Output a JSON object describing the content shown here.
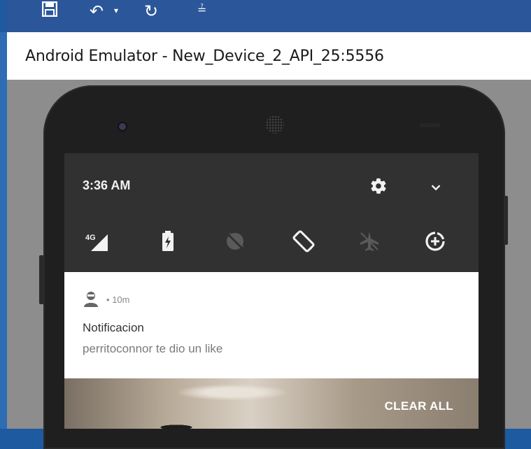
{
  "window": {
    "title": "Android Emulator - New_Device_2_API_25:5556",
    "toolbar_icons": [
      "save-icon",
      "undo-icon",
      "dropdown-arrow-icon",
      "redo-icon",
      "customize-icon"
    ]
  },
  "status": {
    "time": "3:36 AM",
    "icons": [
      "gear-icon",
      "chevron-down-icon"
    ]
  },
  "quick_settings": [
    {
      "name": "cellular-4g",
      "label": "4G",
      "active": true
    },
    {
      "name": "battery-saver",
      "active": true
    },
    {
      "name": "dnd-off",
      "active": false
    },
    {
      "name": "auto-rotate",
      "active": true
    },
    {
      "name": "airplane-mode",
      "active": false
    },
    {
      "name": "data-saver",
      "active": true
    }
  ],
  "notification": {
    "time": "10m",
    "separator": "•",
    "title": "Notificacion",
    "text": "perritoconnor te dio un like"
  },
  "actions": {
    "clear_all": "CLEAR ALL"
  },
  "colors": {
    "titlebar": "#2b579a",
    "shade": "#313131",
    "card": "#ffffff"
  }
}
